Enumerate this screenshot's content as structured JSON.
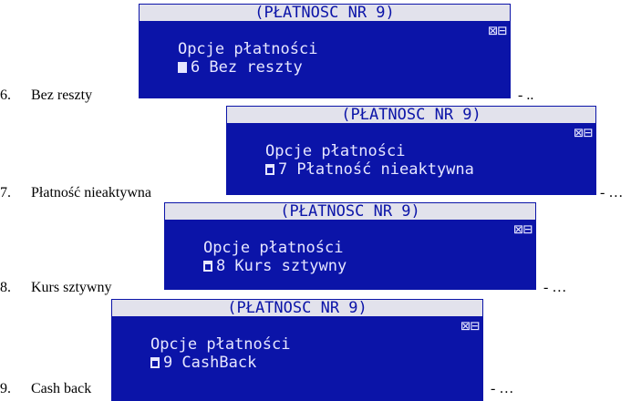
{
  "items": [
    {
      "number": "6.",
      "caption": "Bez reszty",
      "suffix": "- ..",
      "screen": {
        "title": "(PŁATNOSC NR 9)",
        "subtitle": "Opcje płatności",
        "status_icon": "⊠⊟",
        "option_mark": "filled-square",
        "option_text": "6 Bez reszty"
      }
    },
    {
      "number": "7.",
      "caption": "Płatność nieaktywna",
      "suffix": "- …",
      "screen": {
        "title": "(PŁATNOSC NR 9)",
        "subtitle": "Opcje płatności",
        "status_icon": "⊠⊟",
        "option_mark": "empty-square",
        "option_text": "7 Płatność nieaktywna"
      }
    },
    {
      "number": "8.",
      "caption": "Kurs sztywny",
      "suffix": "- …",
      "screen": {
        "title": "(PŁATNOSC NR 9)",
        "subtitle": "Opcje płatności",
        "status_icon": "⊠⊟",
        "option_mark": "empty-square",
        "option_text": "8 Kurs sztywny"
      }
    },
    {
      "number": "9.",
      "caption": "Cash back",
      "suffix": "- …",
      "screen": {
        "title": "(PŁATNOSC NR 9)",
        "subtitle": "Opcje płatności",
        "status_icon": "⊠⊟",
        "option_mark": "empty-square",
        "option_text": "9 CashBack"
      }
    }
  ],
  "colors": {
    "lcd_background": "#0b14a8",
    "lcd_text": "#e6e6ff",
    "title_bar": "#e2e2ec"
  }
}
